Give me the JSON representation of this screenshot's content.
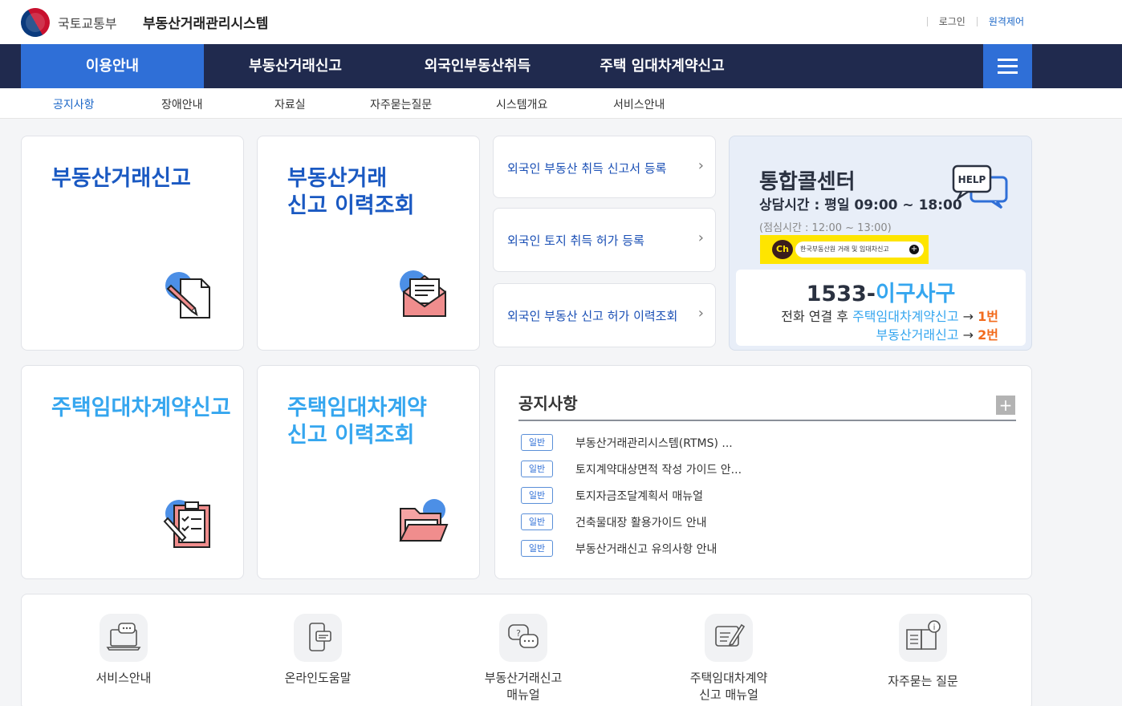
{
  "header": {
    "ministry": "국토교통부",
    "system_title": "부동산거래관리시스템",
    "login": "로그인",
    "remote": "원격제어"
  },
  "nav": {
    "items": [
      "이용안내",
      "부동산거래신고",
      "외국인부동산취득",
      "주택 임대차계약신고"
    ]
  },
  "subnav": {
    "items": [
      "공지사항",
      "장애안내",
      "자료실",
      "자주묻는질문",
      "시스템개요",
      "서비스안내"
    ]
  },
  "cards": {
    "realestate": "부동산거래신고",
    "history1_l1": "부동산거래",
    "history1_l2": "신고 이력조회",
    "lease": "주택임대차계약신고",
    "history2_l1": "주택임대차계약",
    "history2_l2": "신고 이력조회"
  },
  "links": [
    "외국인 부동산 취득 신고서 등록",
    "외국인 토지 취득 허가 등록",
    "외국인 부동산 신고 허가 이력조회"
  ],
  "callcenter": {
    "title": "통합콜센터",
    "hours": "상담시간 : 평일 09:00 ~ 18:00",
    "lunch": "(점심시간 : 12:00 ~ 13:00)",
    "kakao_ch": "Ch",
    "kakao_text": "한국부동산원 거래 및 임대차신고",
    "help": "HELP",
    "phone_num": "1533-",
    "phone_hangul": "이구사구",
    "line1_prefix": "전화 연결 후 ",
    "line1_target": "주택임대차계약신고",
    "line1_arrow": " → ",
    "line1_num": "1번",
    "line2_target": "부동산거래신고",
    "line2_arrow": " → ",
    "line2_num": "2번"
  },
  "notice": {
    "title": "공지사항",
    "plus": "+",
    "badge": "일반",
    "items": [
      "부동산거래관리시스템(RTMS) ...",
      "토지계약대상면적 작성 가이드 안...",
      "토지자금조달계획서 매뉴얼",
      "건축물대장 활용가이드 안내",
      "부동산거래신고 유의사항 안내"
    ]
  },
  "quick": {
    "service": "서비스안내",
    "online_help": "온라인도움말",
    "manual1_l1": "부동산거래신고",
    "manual1_l2": "매뉴얼",
    "manual2_l1": "주택임대차계약",
    "manual2_l2": "신고 매뉴얼",
    "faq": "자주묻는 질문"
  }
}
